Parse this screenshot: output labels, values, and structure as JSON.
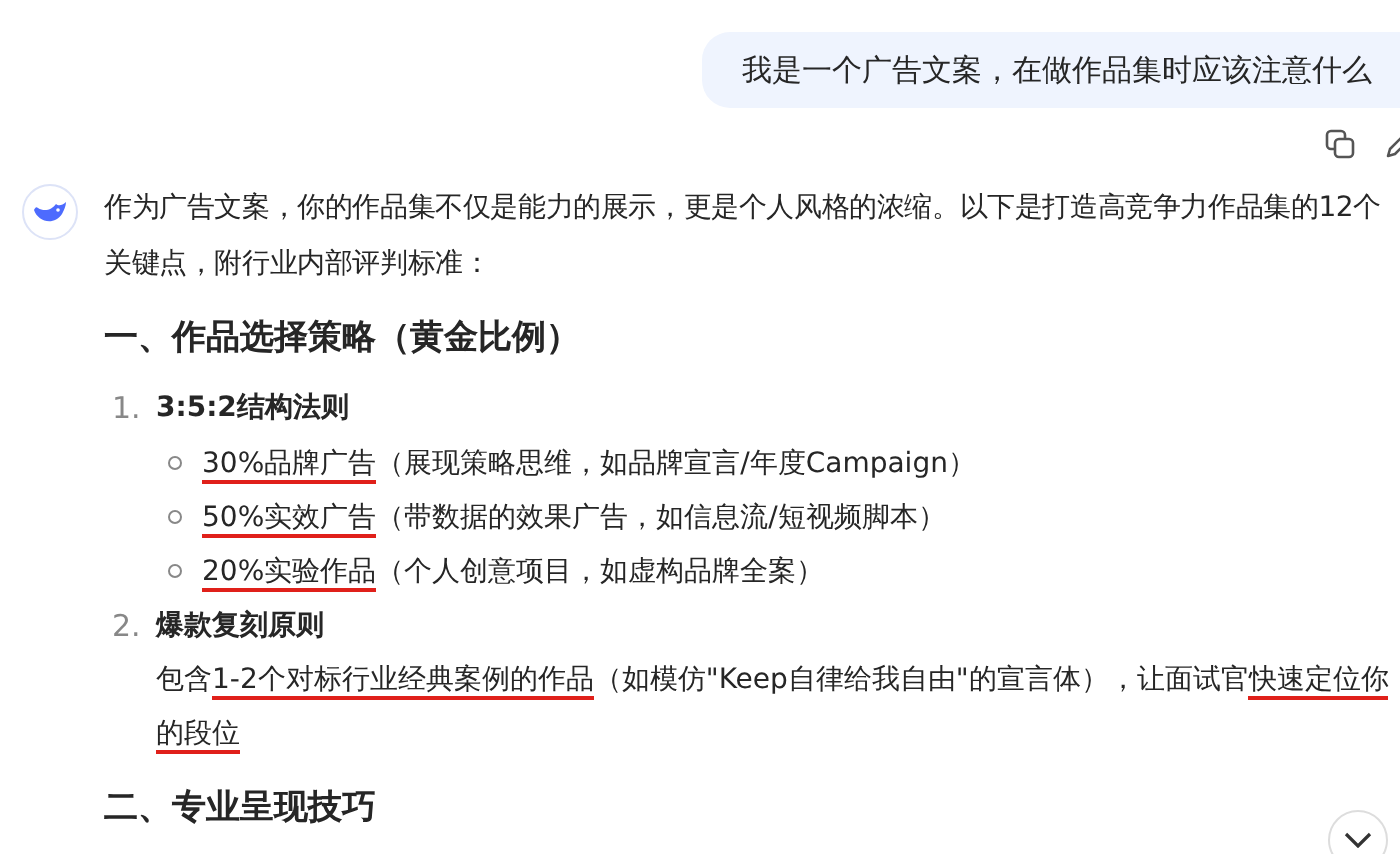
{
  "user_message": {
    "text": "我是一个广告文案，在做作品集时应该注意什么"
  },
  "reply": {
    "intro_lines": [
      "作为广告文案，你的作品集不仅是能力的展示，更是个人风格的浓缩。以下是打造高竞争力作品集的12个",
      "关键点，附行业内部评判标准："
    ],
    "sections": [
      {
        "heading": "一、作品选择策略（黄金比例）",
        "items": [
          {
            "number": "1.",
            "title": "3:5:2结构法则",
            "bullets": [
              [
                {
                  "text": "30%品牌广告",
                  "underlined": true
                },
                {
                  "text": "（展现策略思维，如品牌宣言/年度Campaign）",
                  "underlined": false
                }
              ],
              [
                {
                  "text": "50%实效广告",
                  "underlined": true
                },
                {
                  "text": "（带数据的效果广告，如信息流/短视频脚本）",
                  "underlined": false
                }
              ],
              [
                {
                  "text": "20%实验作品",
                  "underlined": true
                },
                {
                  "text": "（个人创意项目，如虚构品牌全案）",
                  "underlined": false
                }
              ]
            ]
          },
          {
            "number": "2.",
            "title": "爆款复刻原则",
            "lines": [
              [
                {
                  "text": "包含",
                  "underlined": false
                },
                {
                  "text": "1-2个对标行业经典案例的作品",
                  "underlined": true
                },
                {
                  "text": "（如模仿\"Keep自律给我自由\"的宣言体），让面试官",
                  "underlined": false
                },
                {
                  "text": "快速定位你",
                  "underlined": true
                }
              ],
              [
                {
                  "text": "的段位",
                  "underlined": true
                }
              ]
            ]
          }
        ]
      },
      {
        "heading": "二、专业呈现技巧"
      }
    ]
  }
}
